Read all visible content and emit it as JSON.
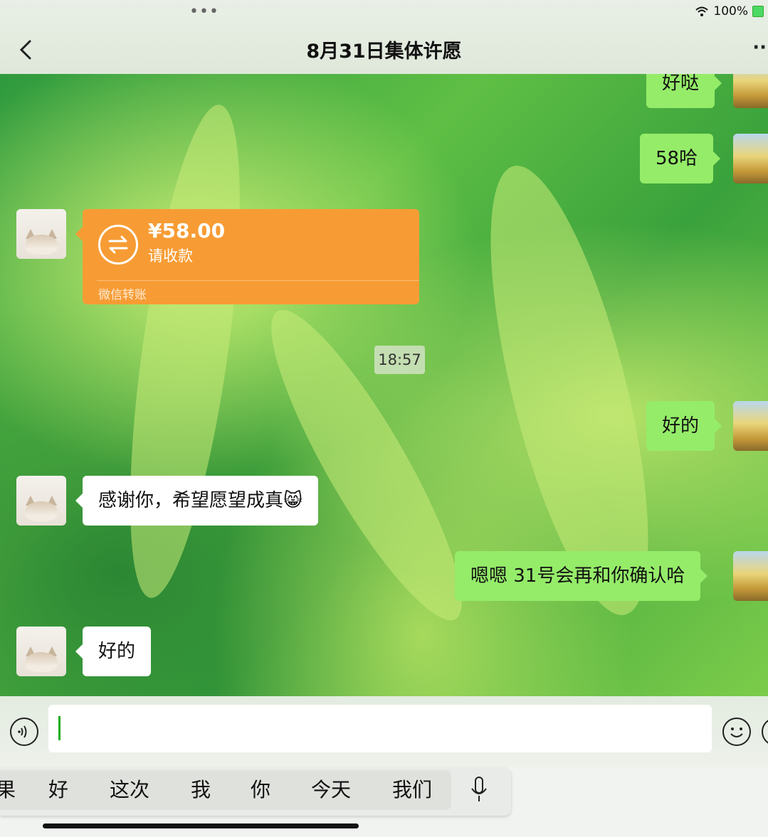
{
  "status": {
    "battery_text": "100%"
  },
  "header": {
    "title": "8月31日集体许愿",
    "more": "··"
  },
  "messages": {
    "me1": "好哒",
    "me2": "58哈",
    "transfer": {
      "amount": "¥58.00",
      "sub": "请收款",
      "label": "微信转账"
    },
    "time": "18:57",
    "me3": "好的",
    "them1": "感谢你，希望愿望成真😸",
    "me4": "嗯嗯 31号会再和你确认哈",
    "them2": "好的"
  },
  "keyboard": {
    "suggestions": [
      "果",
      "好",
      "这次",
      "我",
      "你",
      "今天",
      "我们"
    ]
  },
  "colors": {
    "my_bubble": "#95ec69",
    "transfer": "#f79c34",
    "accent": "#1aad19"
  }
}
